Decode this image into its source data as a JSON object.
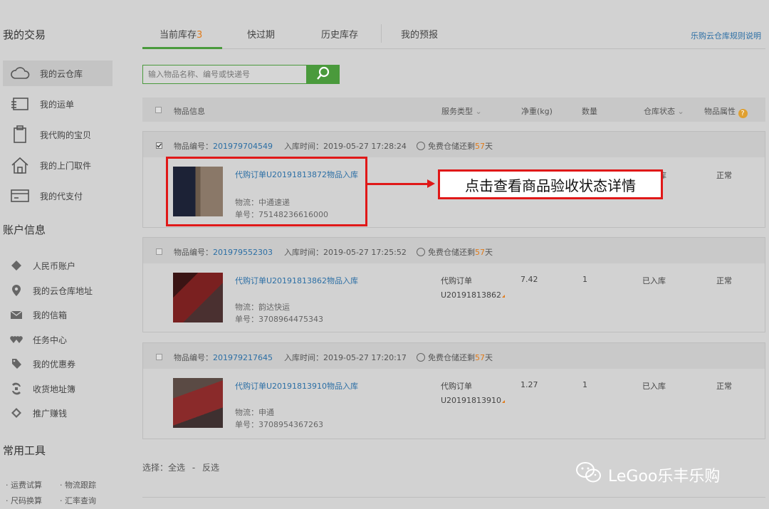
{
  "sidebar": {
    "trade_heading": "我的交易",
    "trade_items": [
      {
        "label": "我的云仓库",
        "icon": "cloud-icon"
      },
      {
        "label": "我的运单",
        "icon": "waybill-icon"
      },
      {
        "label": "我代购的宝贝",
        "icon": "clipboard-icon"
      },
      {
        "label": "我的上门取件",
        "icon": "house-icon"
      },
      {
        "label": "我的代支付",
        "icon": "card-icon"
      }
    ],
    "account_heading": "账户信息",
    "account_items": [
      {
        "label": "人民币账户",
        "icon": "diamond-icon"
      },
      {
        "label": "我的云仓库地址",
        "icon": "location-pin-icon"
      },
      {
        "label": "我的信箱",
        "icon": "envelope-icon"
      },
      {
        "label": "任务中心",
        "icon": "hearts-icon"
      },
      {
        "label": "我的优惠券",
        "icon": "coupon-icon"
      },
      {
        "label": "收货地址簿",
        "icon": "address-book-icon"
      },
      {
        "label": "推广赚钱",
        "icon": "promote-icon"
      }
    ],
    "tools_heading": "常用工具",
    "tools": [
      "运费试算",
      "物流跟踪",
      "尺码换算",
      "汇率查询"
    ]
  },
  "tabs": [
    {
      "label": "当前库存",
      "count": "3"
    },
    {
      "label": "快过期"
    },
    {
      "label": "历史库存"
    },
    {
      "label": "我的预报"
    }
  ],
  "rules_link": "乐购云仓库规则说明",
  "search": {
    "placeholder": "输入物品名称、编号或快递号"
  },
  "table_header": {
    "info": "物品信息",
    "service": "服务类型",
    "weight": "净重(kg)",
    "qty": "数量",
    "status": "仓库状态",
    "attr": "物品属性"
  },
  "labels": {
    "item_no": "物品编号：",
    "in_time": "入库时间：",
    "free_prefix": "免费仓储还剩",
    "free_suffix": "天",
    "logistics": "物流：",
    "tracking": "单号："
  },
  "items": [
    {
      "item_no": "201979704549",
      "in_time": "2019-05-27 17:28:24",
      "free_days": "57",
      "order_title": "代购订单U20191813872物品入库",
      "courier": "中通速递",
      "tracking_no": "75148236616000",
      "service": "",
      "order_no": "",
      "weight": "",
      "qty": "",
      "status": "库",
      "attr": "正常",
      "checked": true
    },
    {
      "item_no": "201979552303",
      "in_time": "2019-05-27 17:25:52",
      "free_days": "57",
      "order_title": "代购订单U20191813862物品入库",
      "courier": "韵达快运",
      "tracking_no": "3708964475343",
      "service": "代购订单",
      "order_no": "U20191813862",
      "weight": "7.42",
      "qty": "1",
      "status": "已入库",
      "attr": "正常",
      "checked": false
    },
    {
      "item_no": "201979217645",
      "in_time": "2019-05-27 17:20:17",
      "free_days": "57",
      "order_title": "代购订单U20191813910物品入库",
      "courier": "申通",
      "tracking_no": "3708954367263",
      "service": "代购订单",
      "order_no": "U20191813910",
      "weight": "1.27",
      "qty": "1",
      "status": "已入库",
      "attr": "正常",
      "checked": false
    }
  ],
  "annotation": "点击查看商品验收状态详情",
  "footer": {
    "select_label": "选择：",
    "select_all": "全选",
    "separator": "-",
    "invert": "反选"
  },
  "watermark": "LeGoo乐丰乐购",
  "colors": {
    "accent_green": "#4a9a3c",
    "link_blue": "#2c6fa5",
    "highlight_red": "#e01818",
    "days_orange": "#e07b1a"
  }
}
